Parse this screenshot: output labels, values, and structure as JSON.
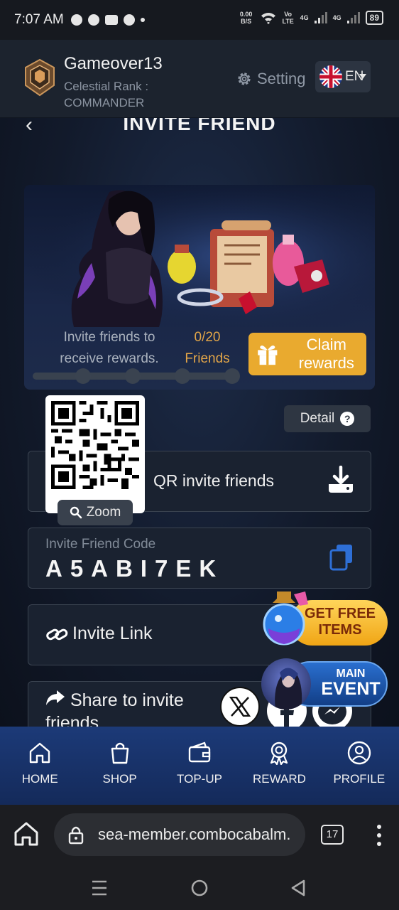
{
  "status_bar": {
    "time": "7:07 AM",
    "net_speed": "0.00 B/S",
    "volte": "Vo LTE",
    "signal1": "4G",
    "signal2": "4G",
    "battery": "89"
  },
  "header": {
    "username": "Gameover13",
    "rank_label": "Celestial Rank :",
    "rank_value": "COMMANDER",
    "setting_label": "Setting",
    "language": "EN"
  },
  "page": {
    "title": "INVITE FRIEND"
  },
  "banner": {
    "invite_text": "Invite friends to receive rewards.",
    "friend_count": "0/20",
    "friends_label": "Friends",
    "claim_label": "Claim rewards",
    "progress": 0
  },
  "detail": {
    "label": "Detail",
    "help_glyph": "?"
  },
  "qr": {
    "label": "QR invite friends",
    "zoom_label": "Zoom"
  },
  "invite_code": {
    "label": "Invite Friend Code",
    "value": "A5ABI7EK"
  },
  "invite_link": {
    "label": "Invite Link"
  },
  "share": {
    "label": "Share to invite friends"
  },
  "floating": {
    "free_items": "GET FREE ITEMS",
    "main_event_small": "MAIN",
    "main_event_big": "EVENT"
  },
  "bottom_nav": {
    "items": [
      {
        "label": "HOME",
        "icon": "home-icon"
      },
      {
        "label": "SHOP",
        "icon": "shopping-bag-icon"
      },
      {
        "label": "TOP-UP",
        "icon": "wallet-icon"
      },
      {
        "label": "REWARD",
        "icon": "medal-icon"
      },
      {
        "label": "PROFILE",
        "icon": "user-icon"
      }
    ]
  },
  "browser": {
    "url": "sea-member.combocabalm.",
    "tab_count": "17"
  },
  "colors": {
    "accent_gold": "#e9aa2f",
    "friend_count": "#e2a548",
    "nav_bg": "#1c3a78",
    "copy_blue": "#2e6fd6"
  }
}
